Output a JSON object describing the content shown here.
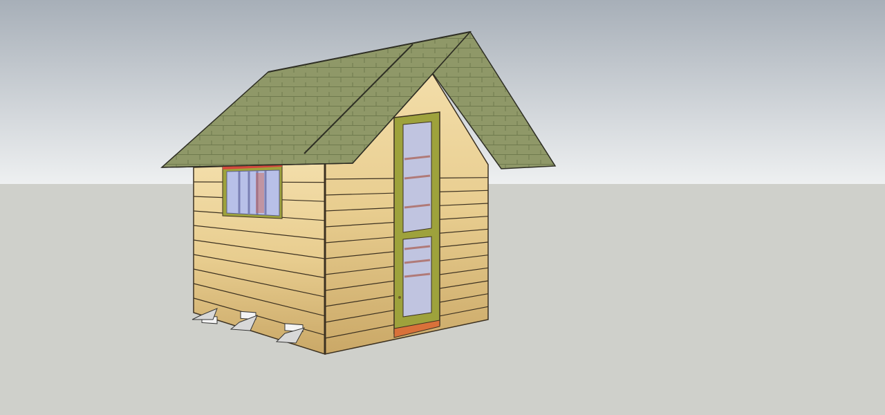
{
  "viewport": {
    "sky_top": "#a7afb8",
    "sky_bottom": "#eef0f1",
    "ground": "#cfd0cb"
  },
  "model": {
    "name_icon": "log-cabin-model",
    "colors": {
      "log": "#e8cd8f",
      "log_light": "#f3deaa",
      "log_edge": "#3b3020",
      "roof": "#8f9868",
      "roof_dark": "#6f7a4e",
      "door_frame": "#9ea23c",
      "door_sill": "#d9713a",
      "glass": "#b8c0e8",
      "window_trim": "#d34a3d"
    }
  }
}
